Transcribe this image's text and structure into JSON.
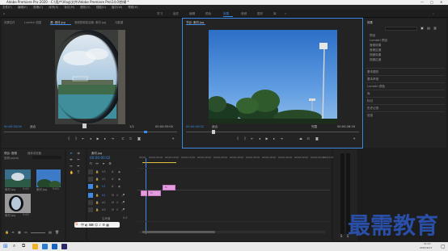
{
  "window": {
    "title": "Adobe Premiere Pro 2020 - C:\\用户\\Vlog\\文件\\Adobe Premiere Pro\\14.0\\剪辑 *",
    "controls": [
      "—",
      "□",
      "✕"
    ]
  },
  "menu": [
    "文件(F)",
    "编辑(E)",
    "剪辑(C)",
    "序列(S)",
    "标记(M)",
    "图形(G)",
    "视图(V)",
    "窗口(W)",
    "帮助(H)"
  ],
  "workspaces": {
    "items": [
      "学习",
      "组件",
      "编辑",
      "颜色",
      "效果",
      "音频",
      "图形",
      "库"
    ],
    "active_index": 4
  },
  "source_panel": {
    "tabs": [
      "效果控件",
      "Lumetri 范围",
      "源: 素材.jpg",
      "音频剪辑混合器: 素材.jpg",
      "元数据"
    ],
    "active_index": 2,
    "timecode_left": "00:00:03:00",
    "fit": "适合",
    "scale": "1/2",
    "timecode_right": "00:00:05:00"
  },
  "program_panel": {
    "tab": "节目: 素材.jpg",
    "timecode_left": "00:00:00:02",
    "fit": "适合",
    "scale": "完整",
    "timecode_right": "00:00:28:16"
  },
  "project_panel": {
    "tabs": [
      "项目: 剪辑",
      "媒体浏览器"
    ],
    "path": "剪辑.prproj",
    "items": [
      {
        "name": "素材.jpg",
        "duration": "5:00"
      },
      {
        "name": "素材.jpg",
        "duration": "5:00"
      },
      {
        "name": "素材.jpg",
        "duration": "5:00"
      }
    ]
  },
  "timeline": {
    "tab": "素材.jpg",
    "timecode": "00:00:00:02",
    "ruler": [
      "00:00",
      "00:00:05:00",
      "00:00:10:00",
      "00:00:15:00",
      "00:00:20:00",
      "00:00:25:00",
      "00:00:30:00",
      "00:00:35:00",
      "00:00:40:00",
      "00:00:45:00",
      "00:00:50:00",
      "00:00:55:00",
      "00:01:00:00"
    ],
    "video_tracks": [
      "V3",
      "V2",
      "V1"
    ],
    "audio_tracks": [
      "A1",
      "A2",
      "A3"
    ],
    "master": "主声道",
    "master_value": "0.0",
    "clips": [
      "fx",
      "fx"
    ]
  },
  "right_panel": {
    "header": "效果",
    "tree": [
      "预设",
      "Lumetri 预设",
      "音频效果",
      "音频过渡",
      "视频效果",
      "视频过渡"
    ],
    "sections": [
      "基本图形",
      "基本声音",
      "Lumetri 颜色",
      "库",
      "标记",
      "历史记录",
      "信息"
    ]
  },
  "watermark": "最需教育",
  "taskbar": {
    "time": "11:17",
    "date": "2021/9/17"
  },
  "colors": {
    "accent": "#3c8ae6",
    "clip": "#e49be0",
    "audio_meter": "#4caf50"
  }
}
